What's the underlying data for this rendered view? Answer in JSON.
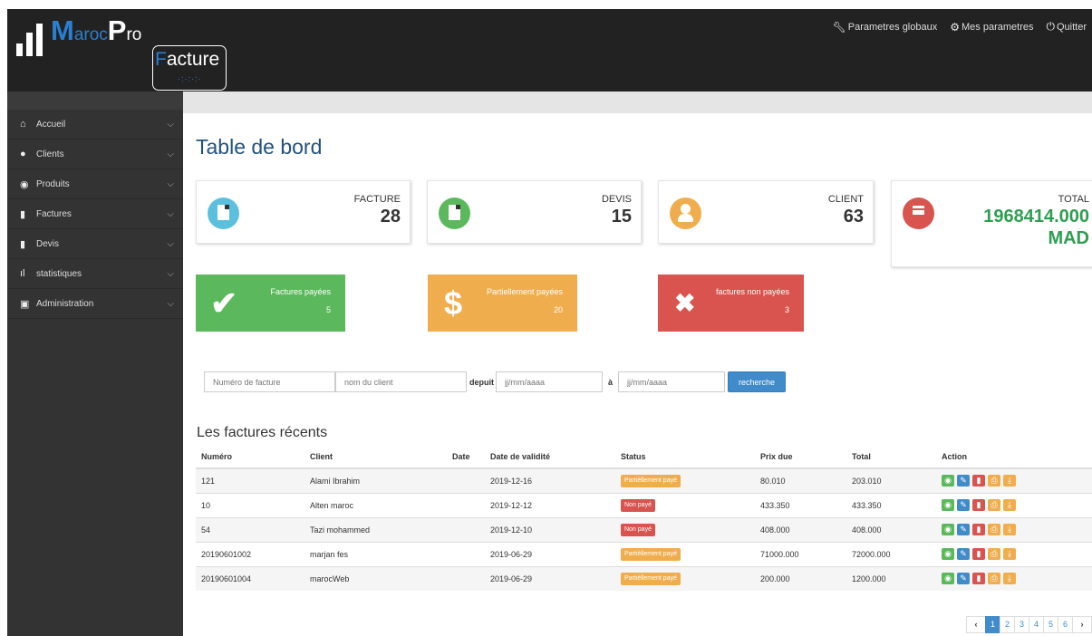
{
  "brand": {
    "name_m": "M",
    "name_aroc": "aroc",
    "name_p": "P",
    "name_ro": "ro",
    "sub_f": "F",
    "sub_acture": "acture"
  },
  "topnav": [
    {
      "icon": "wrench-icon",
      "label": "Parametres globaux"
    },
    {
      "icon": "gear-icon",
      "label": "Mes parametres"
    },
    {
      "icon": "power-icon",
      "label": "Quitter"
    }
  ],
  "sidebar": {
    "items": [
      {
        "icon": "home-icon",
        "label": "Accueil"
      },
      {
        "icon": "user-icon",
        "label": "Clients"
      },
      {
        "icon": "product-icon",
        "label": "Produits"
      },
      {
        "icon": "file-icon",
        "label": "Factures"
      },
      {
        "icon": "file-icon",
        "label": "Devis"
      },
      {
        "icon": "chart-icon",
        "label": "statistiques"
      },
      {
        "icon": "lock-icon",
        "label": "Administration"
      }
    ]
  },
  "page_title": "Table de bord",
  "cards": {
    "facture": {
      "label": "FACTURE",
      "value": "28",
      "color": "#5bc0de"
    },
    "devis": {
      "label": "DEVIS",
      "value": "15",
      "color": "#5cb85c"
    },
    "client": {
      "label": "CLIENT",
      "value": "63",
      "color": "#f0ad4e"
    },
    "total": {
      "label": "TOTAL",
      "value": "1968414.000",
      "unit": "MAD",
      "color": "#d9534f"
    }
  },
  "status_boxes": {
    "payees": {
      "label": "Factures payées",
      "count": "5",
      "color": "#5cb85c"
    },
    "partiel": {
      "label": "Partiellement payées",
      "count": "20",
      "color": "#f0ad4e"
    },
    "non_payees": {
      "label": "factures non payées",
      "count": "3",
      "color": "#d9534f"
    }
  },
  "search": {
    "numero_placeholder": "Numéro de facture",
    "client_placeholder": "nom du client",
    "depuis_label": "depuit",
    "date_from_placeholder": "jj/mm/aaaa",
    "a_label": "à",
    "date_to_placeholder": "jj/mm/aaaa",
    "button": "recherche"
  },
  "recent_title": "Les factures récents",
  "table": {
    "headers": [
      "Numéro",
      "Client",
      "Date",
      "Date de validité",
      "Status",
      "Prix due",
      "Total",
      "Action"
    ],
    "rows": [
      {
        "numero": "121",
        "client": "Alami Ibrahim",
        "date": "",
        "validite": "2019-12-16",
        "status": "Partièllement payé",
        "status_color": "#f0ad4e",
        "prix_due": "80.010",
        "total": "203.010"
      },
      {
        "numero": "10",
        "client": "Alten maroc",
        "date": "",
        "validite": "2019-12-12",
        "status": "Non payé",
        "status_color": "#d9534f",
        "prix_due": "433.350",
        "total": "433.350"
      },
      {
        "numero": "54",
        "client": "Tazi mohammed",
        "date": "",
        "validite": "2019-12-10",
        "status": "Non payé",
        "status_color": "#d9534f",
        "prix_due": "408.000",
        "total": "408.000"
      },
      {
        "numero": "20190601002",
        "client": "marjan fes",
        "date": "",
        "validite": "2019-06-29",
        "status": "Partièllement payé",
        "status_color": "#f0ad4e",
        "prix_due": "71000.000",
        "total": "72000.000"
      },
      {
        "numero": "20190601004",
        "client": "marocWeb",
        "date": "",
        "validite": "2019-06-29",
        "status": "Partièllement payé",
        "status_color": "#f0ad4e",
        "prix_due": "200.000",
        "total": "1200.000"
      }
    ],
    "actions": [
      {
        "icon": "eye-icon",
        "color": "#5cb85c"
      },
      {
        "icon": "pencil-icon",
        "color": "#428bca"
      },
      {
        "icon": "trash-icon",
        "color": "#d9534f"
      },
      {
        "icon": "print-icon",
        "color": "#f0ad4e"
      },
      {
        "icon": "download-icon",
        "color": "#f0ad4e"
      }
    ]
  },
  "pagination": {
    "prev": "‹",
    "pages": [
      "1",
      "2",
      "3",
      "4",
      "5",
      "6"
    ],
    "next": "›",
    "active": "1"
  }
}
